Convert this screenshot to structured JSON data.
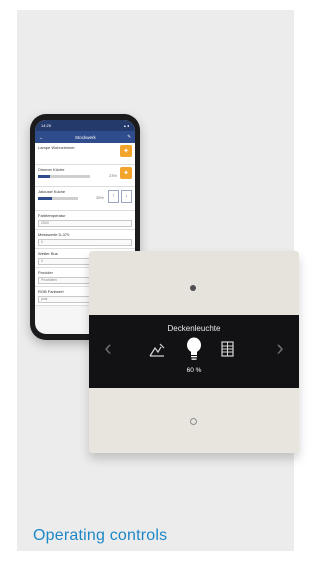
{
  "phone": {
    "status_time": "14:25",
    "status_icons": "▴ ◂",
    "app_title": "Stockwerk",
    "rows": [
      {
        "label": "Lampe Wohnzimmer"
      },
      {
        "label": "Dimmer Küche",
        "value": "23%",
        "level": 0.23
      },
      {
        "label": "Jalousie Küche",
        "value": "35%",
        "level": 0.35,
        "up_label": "AUF",
        "down_label": "AB"
      },
      {
        "label": "Farbtemperatur",
        "field": "2500"
      },
      {
        "label": "Messwerte D-370",
        "field": "0"
      },
      {
        "label": "Wetter Bus",
        "field": "0"
      },
      {
        "label": "Provider",
        "field": "Prioritäten"
      },
      {
        "label": "RGB Farbwert",
        "field": "pink"
      }
    ]
  },
  "switch": {
    "title": "Deckenleuchte",
    "value": "60 %",
    "left_arrow": "‹",
    "right_arrow": "›"
  },
  "caption": "Operating controls",
  "colors": {
    "card": "#ececec",
    "caption": "#1d87c6",
    "app_bar": "#2f4c8c",
    "accent": "#f3a42a"
  }
}
